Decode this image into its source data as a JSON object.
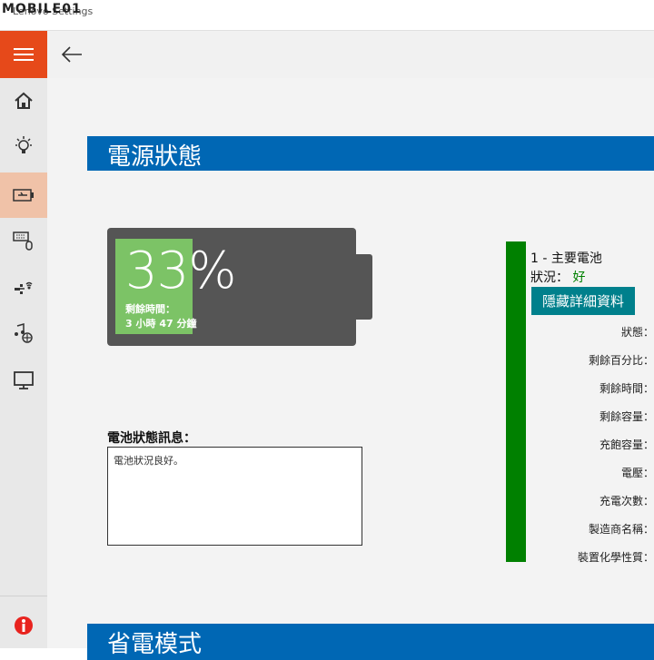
{
  "window": {
    "title": "Lenovo Settings",
    "watermark": "MOBILE01"
  },
  "sidebar": {
    "items": [
      {
        "name": "home",
        "icon": "home-icon"
      },
      {
        "name": "tips",
        "icon": "lightbulb-icon"
      },
      {
        "name": "power",
        "icon": "battery-icon",
        "active": true
      },
      {
        "name": "input",
        "icon": "keyboard-mouse-icon"
      },
      {
        "name": "network",
        "icon": "network-icon"
      },
      {
        "name": "audio",
        "icon": "audio-icon"
      },
      {
        "name": "display",
        "icon": "monitor-icon"
      }
    ],
    "bottom_icon": "feedback-icon"
  },
  "page": {
    "section_title": "電源狀態",
    "next_section_title": "省電模式"
  },
  "battery": {
    "percent_text": "33%",
    "percent_value": 33,
    "remaining_label": "剩餘時間：",
    "remaining_value": "3 小時 47 分鐘",
    "status_msg_label": "電池狀態訊息：",
    "status_msg": "電池狀況良好。"
  },
  "battery_detail": {
    "name": "1 - 主要電池",
    "status_label": "狀況：",
    "status_value": "好",
    "hide_button": "隱藏詳細資料",
    "fields": [
      "狀態：",
      "剩餘百分比：",
      "剩餘時間：",
      "剩餘容量：",
      "充飽容量：",
      "電壓：",
      "充電次數：",
      "製造商名稱：",
      "裝置化學性質："
    ]
  },
  "colors": {
    "accent_orange": "#e6491a",
    "header_blue": "#0067b4",
    "battery_green": "#7cc366",
    "status_green": "#008000",
    "teal_button": "#00808c"
  }
}
